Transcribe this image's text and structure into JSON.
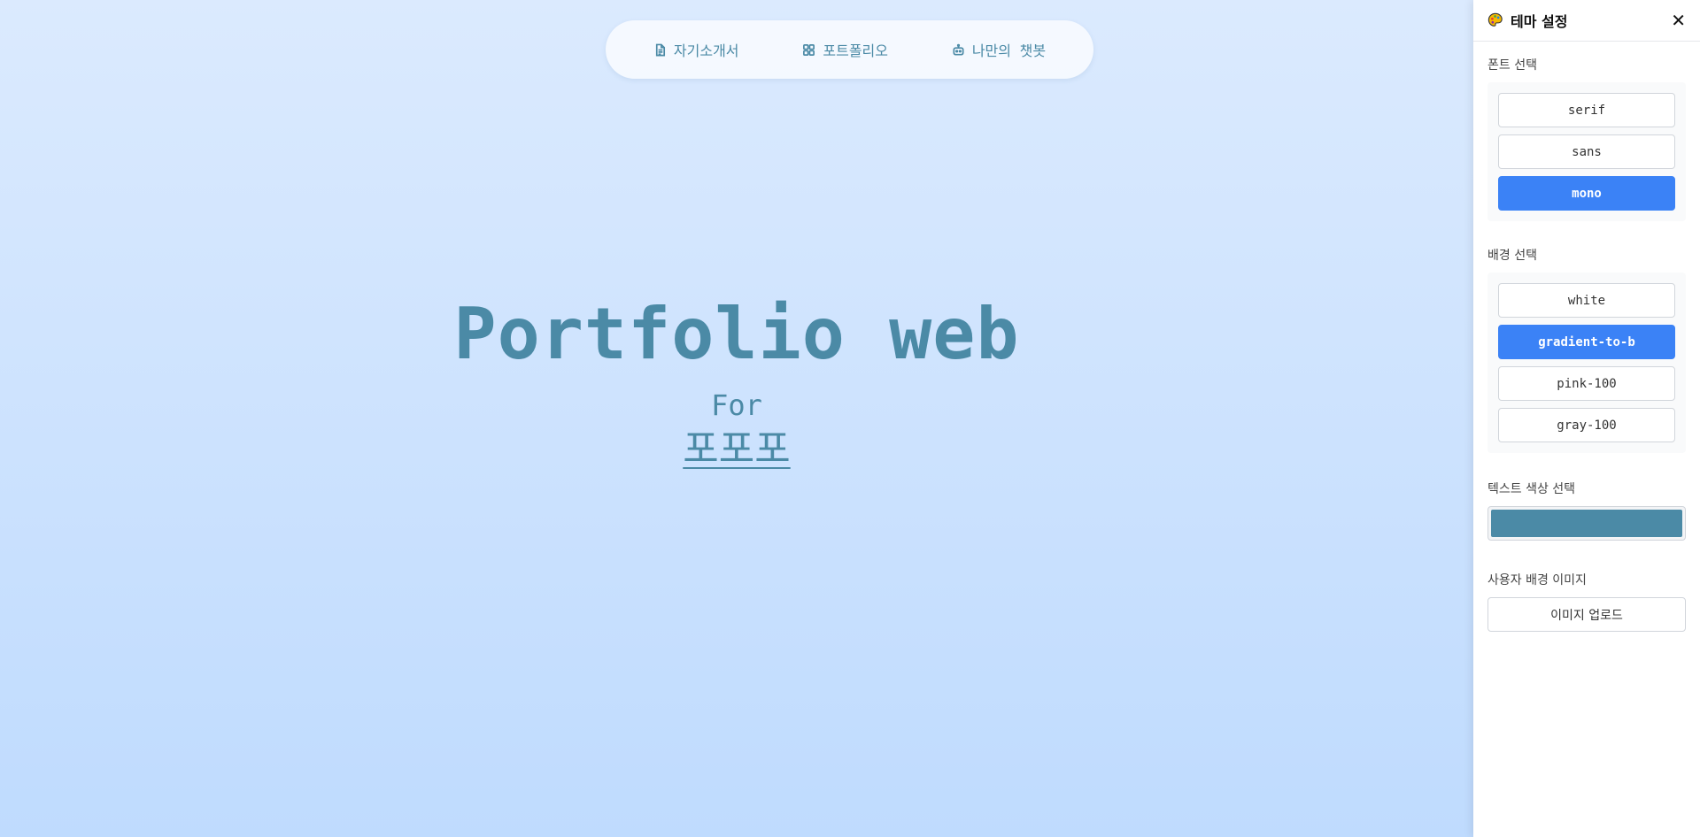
{
  "nav": {
    "items": [
      {
        "label": "자기소개서",
        "icon": "document-icon"
      },
      {
        "label": "포트폴리오",
        "icon": "grid-icon"
      },
      {
        "label": "나만의 챗봇",
        "icon": "bot-icon"
      }
    ]
  },
  "hero": {
    "title": "Portfolio web",
    "for_label": "For",
    "name": "포포포"
  },
  "panel": {
    "title": "테마 설정",
    "icon": "palette-icon",
    "close": "✕",
    "font_section": {
      "label": "폰트 선택",
      "options": [
        "serif",
        "sans",
        "mono"
      ],
      "selected": "mono"
    },
    "bg_section": {
      "label": "배경 선택",
      "options": [
        "white",
        "gradient-to-b",
        "pink-100",
        "gray-100"
      ],
      "selected": "gradient-to-b"
    },
    "text_color_section": {
      "label": "텍스트 색상 선택",
      "value": "#4b8aa6"
    },
    "bg_image_section": {
      "label": "사용자 배경 이미지",
      "upload_label": "이미지 업로드"
    }
  },
  "colors": {
    "accent": "#3b82f6",
    "text": "#4b8aa6",
    "bg_top": "#dbeafe",
    "bg_bottom": "#bfdbfe"
  }
}
